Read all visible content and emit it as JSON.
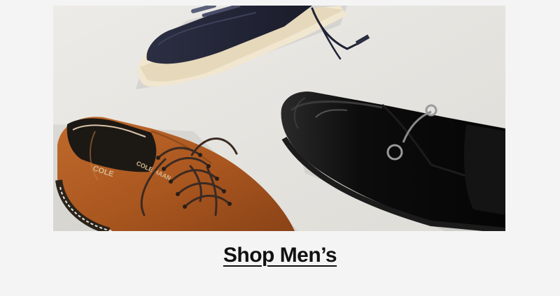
{
  "promo": {
    "cta_label": "Shop Men’s",
    "brand_marks": [
      "COLE",
      "COLE HAAN"
    ]
  },
  "colors": {
    "background": "#f4f4f4",
    "photo_backdrop": "#e7e6e2",
    "cta_text": "#111111"
  },
  "icons": {
    "navy_sneaker": "navy-sneaker-image",
    "black_loafer": "black-loafer-image",
    "tan_oxford": "tan-oxford-image"
  }
}
